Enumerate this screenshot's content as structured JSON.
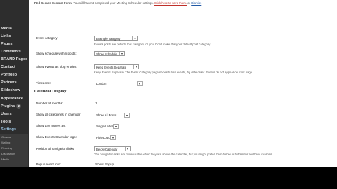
{
  "sidebar": {
    "items": [
      "Media",
      "Links",
      "Pages",
      "Comments",
      "BRAND Pages",
      "Contact",
      "Portfolio",
      "Partners",
      "Slideshow",
      "Appearance",
      "Plugins",
      "Users",
      "Tools",
      "Settings"
    ],
    "plugins_badge": "2",
    "sub_items": [
      "General",
      "Writing",
      "Reading",
      "Discussion",
      "Media"
    ]
  },
  "notice": {
    "label": "Red Secure Contact Form:",
    "message": "You still haven't completed your Meeting Scheduler settings.",
    "link": "Click here to save them.",
    "or": "or",
    "dismiss": "Dismiss"
  },
  "settings": {
    "event_category": {
      "label": "Event category:",
      "value": "Example category",
      "help": "Events posts are put into this category for you. Don't make this your default post category."
    },
    "show_schedule": {
      "label": "Show schedule within posts:",
      "value": "Show Schedule"
    },
    "show_events_blog": {
      "label": "Show events as blog entries:",
      "value": "Keep Events Separate",
      "help": "Keep Events Separate: The Event Category page shows future events, by date order. Events do not appear on front page."
    },
    "timezone": {
      "label": "Timezone:",
      "value": "London"
    }
  },
  "calendar_display": {
    "title": "Calendar Display",
    "number_of_months": {
      "label": "Number of months:",
      "value": "1"
    },
    "show_all_categories": {
      "label": "Show all categories in calendar:",
      "value": "Show All Posts"
    },
    "show_day_names": {
      "label": "Show day names as:",
      "value": "Single Letter"
    },
    "show_logo": {
      "label": "Show Events Calendar logo:",
      "value": "Hide Logo"
    },
    "nav_links": {
      "label": "Position of navigation links:",
      "value": "Below Calendar",
      "help": "The navigation links are more usable when they are above the calendar, but you might prefer them below or hidden for aesthetic reasons."
    },
    "popup": {
      "label": "Popup event info:",
      "value": "Show Popup"
    }
  }
}
